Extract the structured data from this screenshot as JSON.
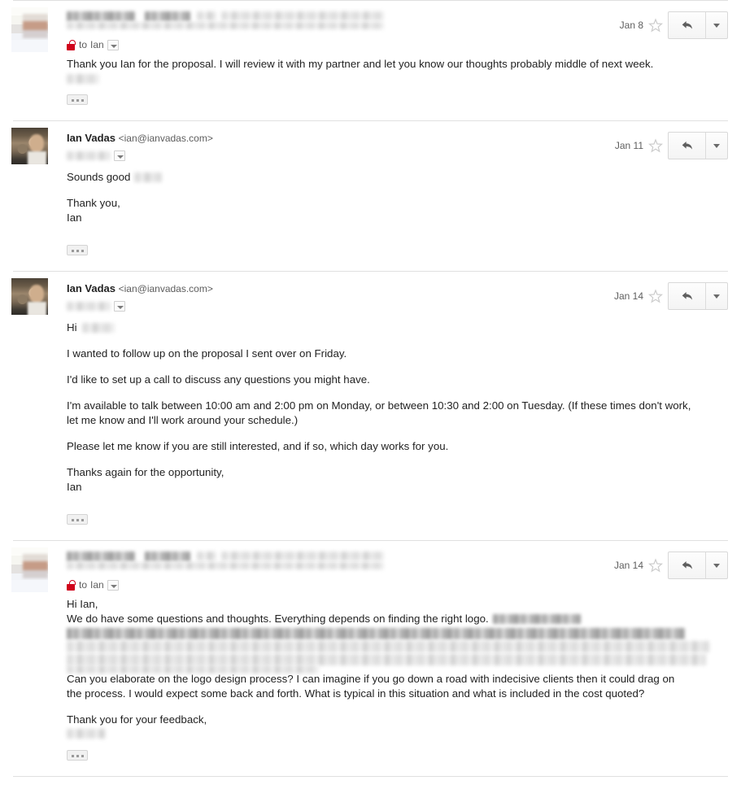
{
  "thread": {
    "messages": [
      {
        "id": "msg-1",
        "sender_redacted": true,
        "sender_name": "",
        "sender_email": "",
        "avatar_type": "blurred-thumbnail",
        "recipient_prefix": "to",
        "recipient_name": "Ian",
        "encryption_icon": "unlocked-padlock-icon",
        "date": "Jan 8",
        "starred": false,
        "star_icon": "star-outline-icon",
        "reply_icon": "reply-arrow-icon",
        "more_icon": "chevron-down-icon",
        "body_paragraphs": [
          "Thank you Ian for the proposal. I will review it with my partner and let you know our thoughts probably middle of next week."
        ],
        "signature_redacted": true,
        "trim_button": "show-trimmed-content"
      },
      {
        "id": "msg-2",
        "sender_redacted": false,
        "sender_name": "Ian Vadas",
        "sender_email": "<ian@ianvadas.com>",
        "avatar_type": "photo",
        "recipient_redacted": true,
        "date": "Jan 11",
        "starred": false,
        "star_icon": "star-outline-icon",
        "reply_icon": "reply-arrow-icon",
        "more_icon": "chevron-down-icon",
        "body_paragraphs": [
          "Sounds good",
          "Thank you,",
          "Ian"
        ],
        "trim_button": "show-trimmed-content"
      },
      {
        "id": "msg-3",
        "sender_redacted": false,
        "sender_name": "Ian Vadas",
        "sender_email": "<ian@ianvadas.com>",
        "avatar_type": "photo",
        "recipient_redacted": true,
        "date": "Jan 14",
        "starred": false,
        "star_icon": "star-outline-icon",
        "reply_icon": "reply-arrow-icon",
        "more_icon": "chevron-down-icon",
        "greeting": "Hi",
        "body_paragraphs": [
          "I wanted to follow up on the proposal I sent over on Friday.",
          "I'd like to set up a call to discuss any questions you might have.",
          "I'm available to talk between 10:00 am and 2:00 pm on Monday, or between 10:30 and 2:00 on Tuesday. (If these times don't work, let me know and I'll work around your schedule.)",
          "Please let me know if you are still interested, and if so, which day works for you.",
          "Thanks again for the opportunity,",
          "Ian"
        ],
        "trim_button": "show-trimmed-content"
      },
      {
        "id": "msg-4",
        "sender_redacted": true,
        "sender_name": "",
        "sender_email": "",
        "avatar_type": "blurred-thumbnail",
        "recipient_prefix": "to",
        "recipient_name": "Ian",
        "encryption_icon": "unlocked-padlock-icon",
        "date": "Jan 14",
        "starred": false,
        "star_icon": "star-outline-icon",
        "reply_icon": "reply-arrow-icon",
        "more_icon": "chevron-down-icon",
        "greeting": "Hi Ian,",
        "line_2": "We do have some questions and thoughts. Everything depends on finding the right logo.",
        "body_paragraphs": [
          "Can you elaborate on the logo design process? I can imagine if you go down a road with indecisive clients then it could drag on the process. I would expect some back and forth. What is typical in this situation and what is included in the cost quoted?",
          "Thank you for your feedback,"
        ],
        "signature_redacted": true,
        "trim_button": "show-trimmed-content"
      }
    ]
  },
  "colors": {
    "divider": "#e0e0e0",
    "text": "#222222",
    "meta_text": "#5e5e5e",
    "lock_red": "#d0021b",
    "button_border": "#d8d8d8",
    "page_background": "#ffffff"
  }
}
